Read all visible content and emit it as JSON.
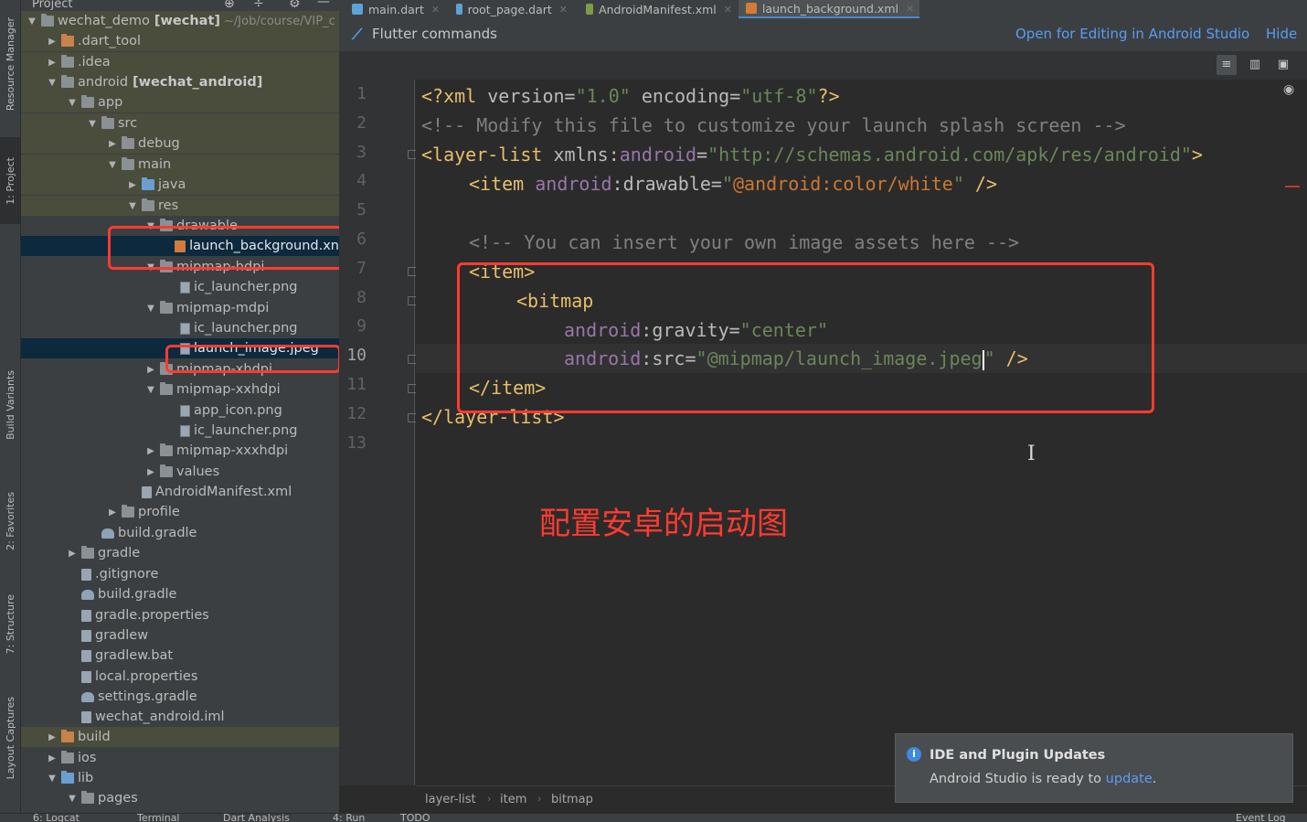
{
  "left_stripe": {
    "tabs": [
      "Resource Manager",
      "1: Project",
      "Build Variants",
      "2: Favorites",
      "7: Structure",
      "Layout Captures"
    ]
  },
  "project_panel": {
    "header": "Project",
    "tree": [
      {
        "arrow": "▼",
        "name": "wechat_demo",
        "bold_suffix": "[wechat]",
        "extra": "~/Job/course/VIP_c"
      },
      {
        "arrow": "▶",
        "name": ".dart_tool"
      },
      {
        "arrow": "▶",
        "name": ".idea"
      },
      {
        "arrow": "▼",
        "name": "android",
        "bold_suffix": "[wechat_android]"
      },
      {
        "arrow": "▼",
        "name": "app"
      },
      {
        "arrow": "▼",
        "name": "src"
      },
      {
        "arrow": "▶",
        "name": "debug"
      },
      {
        "arrow": "▼",
        "name": "main"
      },
      {
        "arrow": "▶",
        "name": "java"
      },
      {
        "arrow": "▼",
        "name": "res"
      },
      {
        "arrow": "▼",
        "name": "drawable"
      },
      {
        "arrow": "",
        "name": "launch_background.xn"
      },
      {
        "arrow": "▼",
        "name": "mipmap-hdpi"
      },
      {
        "arrow": "",
        "name": "ic_launcher.png"
      },
      {
        "arrow": "▼",
        "name": "mipmap-mdpi"
      },
      {
        "arrow": "",
        "name": "ic_launcher.png"
      },
      {
        "arrow": "",
        "name": "launch_image.jpeg"
      },
      {
        "arrow": "▶",
        "name": "mipmap-xhdpi"
      },
      {
        "arrow": "▼",
        "name": "mipmap-xxhdpi"
      },
      {
        "arrow": "",
        "name": "app_icon.png"
      },
      {
        "arrow": "",
        "name": "ic_launcher.png"
      },
      {
        "arrow": "▶",
        "name": "mipmap-xxxhdpi"
      },
      {
        "arrow": "▶",
        "name": "values"
      },
      {
        "arrow": "",
        "name": "AndroidManifest.xml"
      },
      {
        "arrow": "▶",
        "name": "profile"
      },
      {
        "arrow": "",
        "name": "build.gradle"
      },
      {
        "arrow": "▶",
        "name": "gradle"
      },
      {
        "arrow": "",
        "name": ".gitignore"
      },
      {
        "arrow": "",
        "name": "build.gradle"
      },
      {
        "arrow": "",
        "name": "gradle.properties"
      },
      {
        "arrow": "",
        "name": "gradlew"
      },
      {
        "arrow": "",
        "name": "gradlew.bat"
      },
      {
        "arrow": "",
        "name": "local.properties"
      },
      {
        "arrow": "",
        "name": "settings.gradle"
      },
      {
        "arrow": "",
        "name": "wechat_android.iml"
      },
      {
        "arrow": "▶",
        "name": "build"
      },
      {
        "arrow": "▶",
        "name": "ios"
      },
      {
        "arrow": "▼",
        "name": "lib"
      },
      {
        "arrow": "▼",
        "name": "pages"
      }
    ]
  },
  "tabs": [
    "main.dart",
    "root_page.dart",
    "AndroidManifest.xml",
    "launch_background.xml"
  ],
  "banner": {
    "title": "Flutter commands",
    "open_link": "Open for Editing in Android Studio",
    "hide_link": "Hide"
  },
  "editor": {
    "line_numbers": [
      "1",
      "2",
      "3",
      "4",
      "5",
      "6",
      "7",
      "8",
      "9",
      "10",
      "11",
      "12",
      "13"
    ],
    "lines": {
      "l1": [
        "<?xml ",
        "version",
        "=",
        "\"1.0\"",
        " encoding",
        "=",
        "\"utf-8\"",
        "?>"
      ],
      "l2": "<!-- Modify this file to customize your launch splash screen -->",
      "l3": [
        "<layer-list ",
        "xmlns:",
        "android",
        "=",
        "\"http://schemas.android.com/apk/res/android\"",
        ">"
      ],
      "l4": [
        "<item ",
        "android",
        ":drawable=",
        "\"",
        "@android:color/white",
        "\"",
        " />"
      ],
      "l6": "<!-- You can insert your own image assets here -->",
      "l7": "<item>",
      "l8": "<bitmap",
      "l9": [
        "android",
        ":gravity=",
        "\"center\""
      ],
      "l10": [
        "android",
        ":src=",
        "\"",
        "@mipmap/launch_image.jpeg",
        "\"",
        " />"
      ],
      "l11": "</item>",
      "l12": "</layer-list>"
    }
  },
  "annotation": "配置安卓的启动图",
  "breadcrumb": [
    "layer-list",
    "item",
    "bitmap"
  ],
  "notification": {
    "title": "IDE and Plugin Updates",
    "body_prefix": "Android Studio is ready to ",
    "body_link": "update",
    "body_suffix": "."
  },
  "statusbar": [
    "6: Logcat",
    "Terminal",
    "Dart Analysis",
    "4: Run",
    "TODO",
    "Event Log"
  ],
  "colors": {
    "annotation_red": "#ff3b30",
    "link_blue": "#589df6",
    "xml_tag": "#e8bf6a",
    "xml_string": "#6a8759",
    "xml_namespace": "#9876aa"
  }
}
